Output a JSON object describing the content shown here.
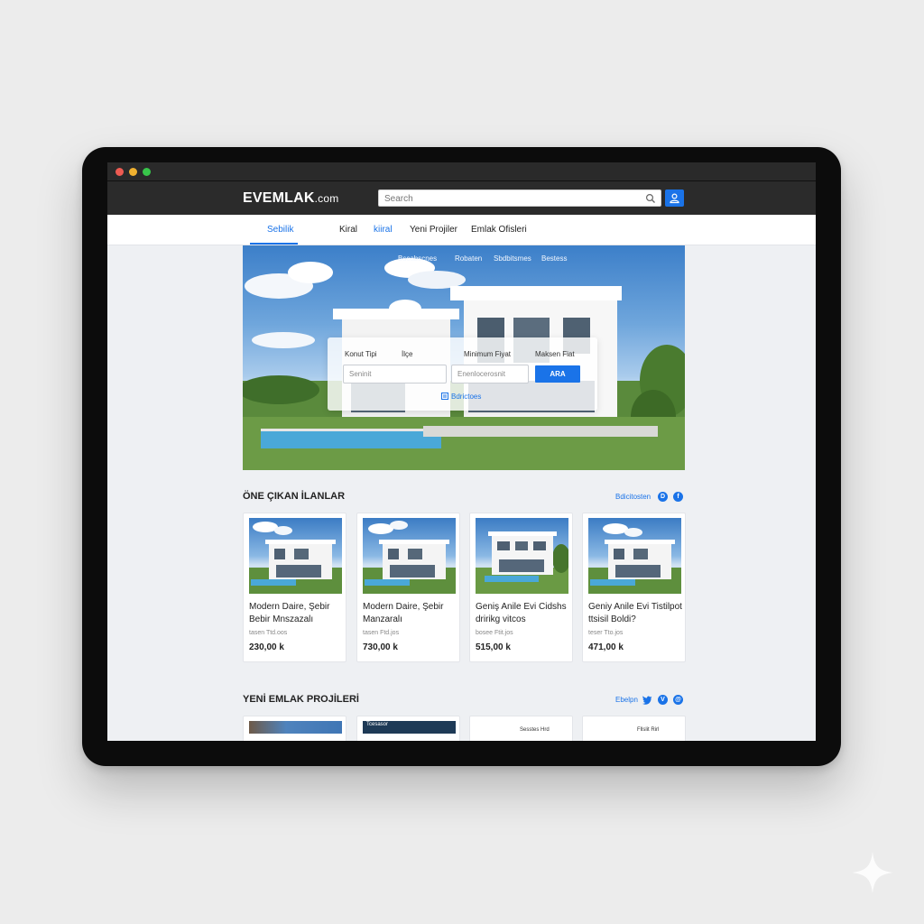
{
  "site": {
    "logo_main": "EVEMLAK",
    "logo_tld": ".com",
    "search_placeholder": "Search"
  },
  "nav": {
    "items": [
      {
        "label": "Sebilik",
        "active": true
      },
      {
        "label": "Kiral",
        "active": false
      },
      {
        "label": "kiiral",
        "active": false
      },
      {
        "label": "Yeni Projiler",
        "active": false
      },
      {
        "label": "Emlak Ofisleri",
        "active": false
      }
    ]
  },
  "hero": {
    "tabs": [
      "Bscabscnes",
      "Robaten",
      "Sbdbitsmes",
      "Bestess"
    ],
    "labels": [
      "Konut Tipi",
      "İlçe",
      "Minimum Fiyat",
      "Maksen Fiat"
    ],
    "fields": [
      "Seninit",
      "Enenlocerosnit"
    ],
    "button": "ARA",
    "link": "Bdrictoes"
  },
  "featured": {
    "title": "ÖNE ÇIKAN İLANLAR",
    "link": "Bdicitosten",
    "icons": [
      "D",
      "f"
    ],
    "cards": [
      {
        "title": "Modern Daire, Şebir Bebir Mnszazalı",
        "meta": "tasen Ttd.oos",
        "price": "230,00 k"
      },
      {
        "title": "Modern Daire, Şebir Manzaralı",
        "meta": "tasen Ftd.jos",
        "price": "730,00 k"
      },
      {
        "title": "Geniş Anile Evi Cidshs dririkg vitcos",
        "meta": "bosee Ftit.jos",
        "price": "515,00 k"
      },
      {
        "title": "Geniy Anile Evi Tistilpot ttsisil Boldi?",
        "meta": "teser Tto.jos",
        "price": "471,00 k"
      }
    ]
  },
  "projects": {
    "title": "YENİ EMLAK PROJİLERİ",
    "link": "Ebelpn",
    "icons": [
      "twitter",
      "V",
      "@"
    ],
    "cards": [
      {
        "caption": ""
      },
      {
        "caption": "Tcesasor"
      },
      {
        "caption": "Sesstes Hrd"
      },
      {
        "caption": "Fllslit Rirl"
      }
    ]
  },
  "colors": {
    "accent": "#1a73e8",
    "topbar": "#2b2b2b",
    "page_bg": "#eef0f3"
  }
}
